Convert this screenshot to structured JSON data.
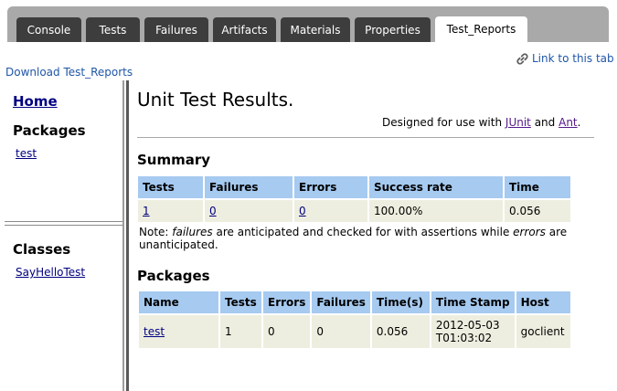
{
  "tabs": [
    {
      "label": "Console",
      "active": false
    },
    {
      "label": "Tests",
      "active": false
    },
    {
      "label": "Failures",
      "active": false
    },
    {
      "label": "Artifacts",
      "active": false
    },
    {
      "label": "Materials",
      "active": false
    },
    {
      "label": "Properties",
      "active": false
    },
    {
      "label": "Test_Reports",
      "active": true
    }
  ],
  "download_link": "Download Test_Reports",
  "tab_link": "Link to this tab",
  "nav": {
    "home": "Home",
    "packages_heading": "Packages",
    "packages": [
      "test"
    ],
    "classes_heading": "Classes",
    "classes": [
      "SayHelloTest"
    ]
  },
  "report": {
    "title": "Unit Test Results.",
    "designed_prefix": "Designed for use with",
    "junit": "JUnit",
    "and": "and",
    "ant": "Ant",
    "designed_suffix": "."
  },
  "summary": {
    "heading": "Summary",
    "headers": [
      "Tests",
      "Failures",
      "Errors",
      "Success rate",
      "Time"
    ],
    "row": [
      "1",
      "0",
      "0",
      "100.00%",
      "0.056"
    ],
    "note_prefix": "Note: ",
    "note_failures": "failures",
    "note_mid": " are anticipated and checked for with assertions while ",
    "note_errors": "errors",
    "note_suffix": " are unanticipated."
  },
  "packages": {
    "heading": "Packages",
    "headers": [
      "Name",
      "Tests",
      "Errors",
      "Failures",
      "Time(s)",
      "Time Stamp",
      "Host"
    ],
    "rows": [
      [
        "test",
        "1",
        "0",
        "0",
        "0.056",
        "2012-05-03T01:03:02",
        "goclient"
      ]
    ]
  },
  "colors": {
    "tabbar": "#a9a9a9",
    "tab": "#3d3d3d",
    "header_cell": "#a6caf0",
    "data_cell": "#eeeee0",
    "link": "#000080"
  }
}
